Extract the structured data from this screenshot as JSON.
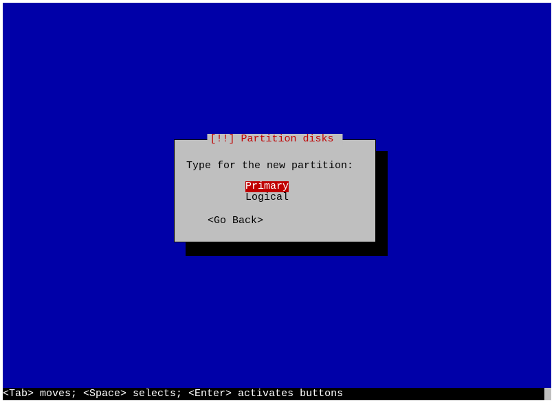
{
  "dialog": {
    "title": "[!!] Partition disks",
    "prompt": "Type for the new partition:",
    "options": [
      {
        "label": "Primary",
        "selected": true
      },
      {
        "label": "Logical",
        "selected": false
      }
    ],
    "go_back": "<Go Back>"
  },
  "statusbar": "<Tab> moves; <Space> selects; <Enter> activates buttons"
}
